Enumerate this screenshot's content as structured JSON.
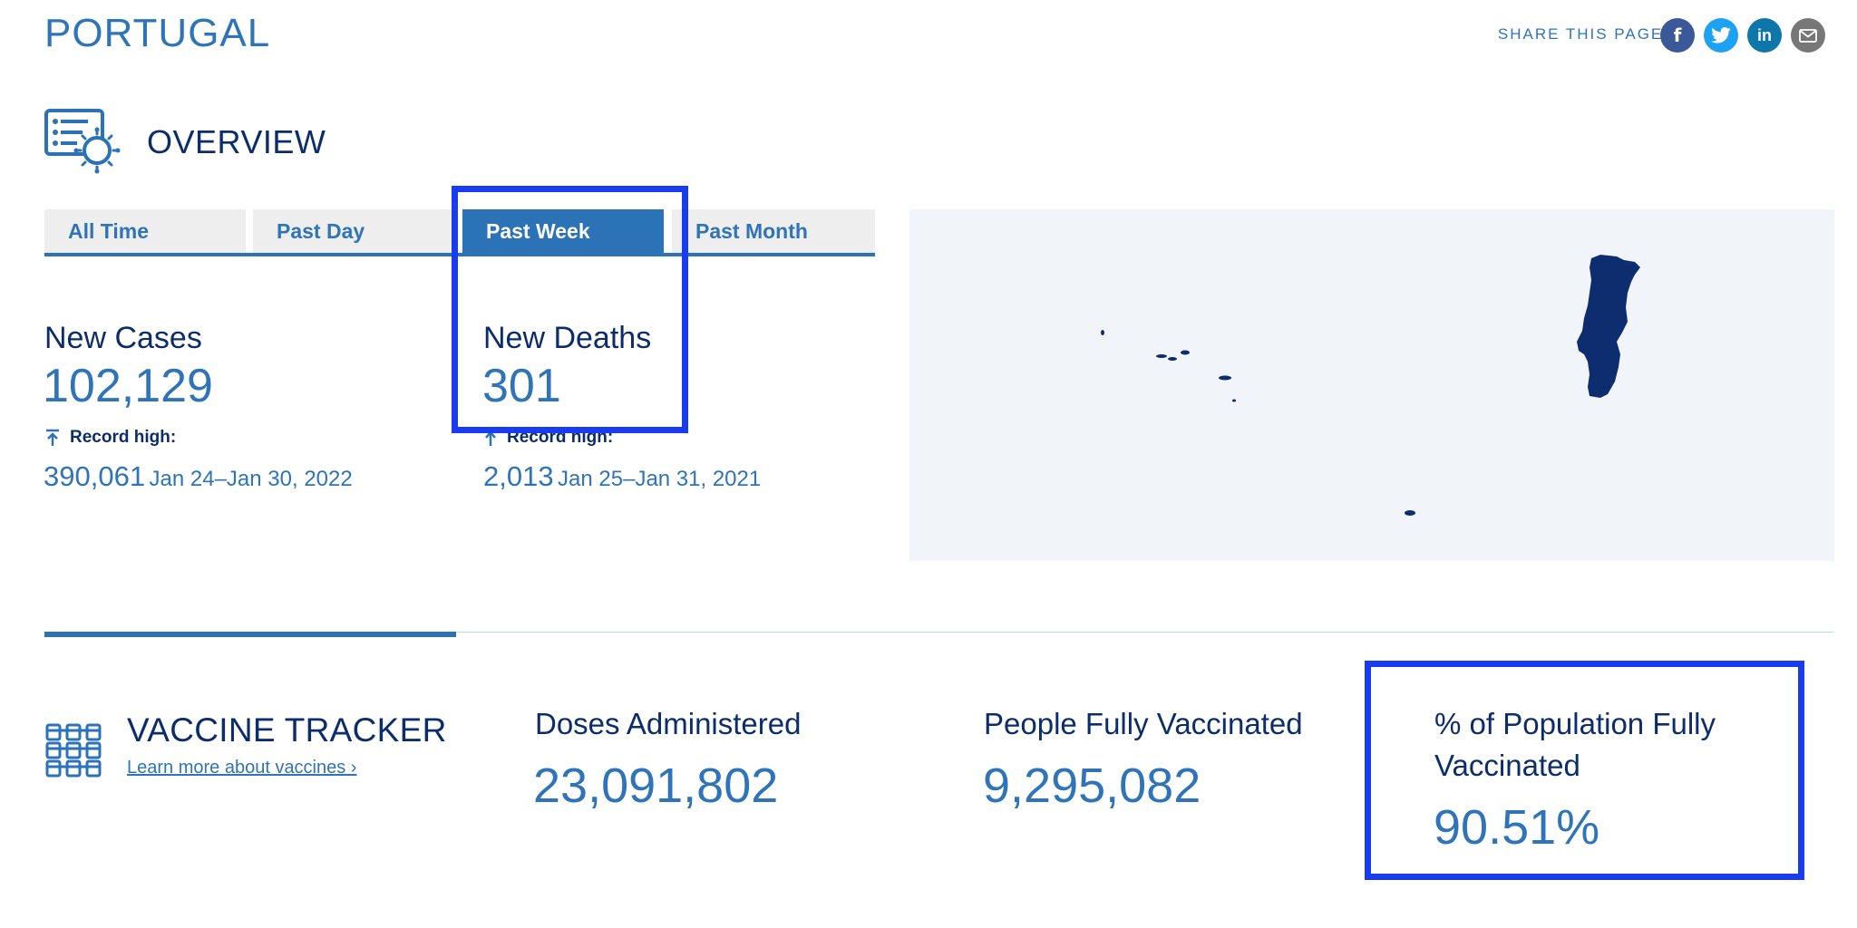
{
  "header": {
    "country": "PORTUGAL",
    "share_label": "SHARE THIS PAGE:",
    "share_buttons": [
      {
        "icon": "facebook-icon",
        "glyph": "f",
        "color": "#3b5998"
      },
      {
        "icon": "twitter-icon",
        "glyph": "🐦",
        "color": "#1da1f2"
      },
      {
        "icon": "linkedin-icon",
        "glyph": "in",
        "color": "#0e76a8"
      },
      {
        "icon": "email-icon",
        "glyph": "✉",
        "color": "#777777"
      }
    ]
  },
  "overview": {
    "title": "OVERVIEW",
    "tabs": [
      {
        "label": "All Time",
        "active": false
      },
      {
        "label": "Past Day",
        "active": false
      },
      {
        "label": "Past Week",
        "active": true
      },
      {
        "label": "Past Month",
        "active": false
      }
    ],
    "new_cases": {
      "label": "New Cases",
      "value": "102,129",
      "record_label": "Record high:",
      "record_value": "390,061",
      "record_date": "Jan 24–Jan 30, 2022"
    },
    "new_deaths": {
      "label": "New Deaths",
      "value": "301",
      "record_label": "Record high:",
      "record_value": "2,013",
      "record_date": "Jan 25–Jan 31, 2021"
    }
  },
  "vaccine": {
    "title": "VACCINE TRACKER",
    "link": "Learn more about vaccines ›",
    "doses": {
      "label": "Doses Administered",
      "value": "23,091,802"
    },
    "fully": {
      "label": "People Fully Vaccinated",
      "value": "9,295,082"
    },
    "percent": {
      "label_line1": "% of Population Fully",
      "label_line2": "Vaccinated",
      "value": "90.51%"
    }
  },
  "colors": {
    "accent": "#2b72b7",
    "navy": "#0c2d6b",
    "map_fill": "#0e2d6e",
    "highlight": "#1a3cf0"
  }
}
